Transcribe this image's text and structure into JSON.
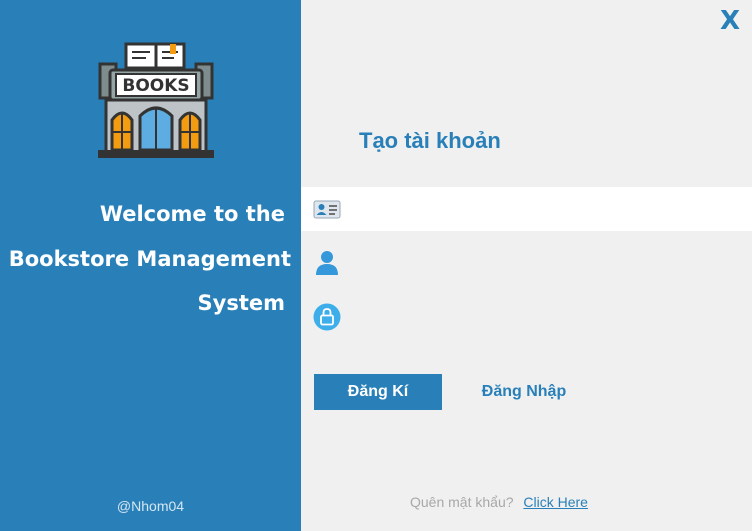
{
  "sidebar": {
    "logo_text": "BOOKS",
    "welcome_lines": [
      "Welcome to the",
      "Bookstore Management",
      "System"
    ],
    "credit": "@Nhom04"
  },
  "window": {
    "close_label": "X"
  },
  "form": {
    "title": "Tạo tài khoản",
    "fields": [
      {
        "icon": "id-card-icon",
        "value": "",
        "placeholder": ""
      },
      {
        "icon": "user-icon",
        "value": "",
        "placeholder": ""
      },
      {
        "icon": "lock-icon",
        "value": "",
        "placeholder": ""
      }
    ],
    "register_label": "Đăng Kí",
    "login_label": "Đăng Nhập",
    "forgot_text": "Quên mật khẩu?",
    "forgot_link": "Click Here"
  },
  "colors": {
    "accent": "#2980b9",
    "panel": "#f0f0f0",
    "muted": "#a8a8a8"
  }
}
